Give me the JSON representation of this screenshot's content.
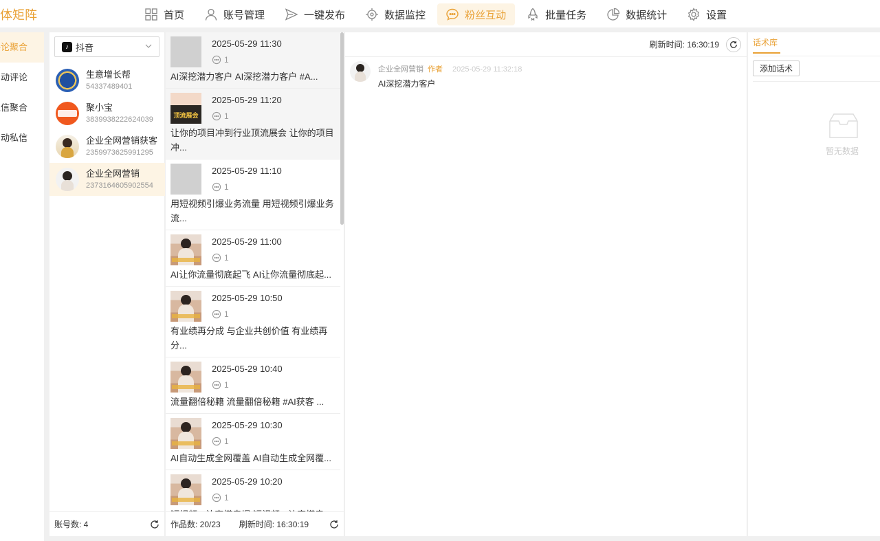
{
  "app": {
    "brand": "体矩阵"
  },
  "nav": [
    {
      "label": "首页",
      "icon": "grid-icon"
    },
    {
      "label": "账号管理",
      "icon": "user-icon"
    },
    {
      "label": "一键发布",
      "icon": "send-icon"
    },
    {
      "label": "数据监控",
      "icon": "target-icon"
    },
    {
      "label": "粉丝互动",
      "icon": "chat-icon",
      "active": true
    },
    {
      "label": "批量任务",
      "icon": "rocket-icon"
    },
    {
      "label": "数据统计",
      "icon": "pie-chart-icon"
    },
    {
      "label": "设置",
      "icon": "gear-icon"
    }
  ],
  "sidenav": [
    {
      "label": "评论聚合",
      "active": true
    },
    {
      "label": "自动评论"
    },
    {
      "label": "私信聚合"
    },
    {
      "label": "自动私信"
    }
  ],
  "platform": {
    "selected": "抖音"
  },
  "accounts": [
    {
      "name": "生意增长帮",
      "id": "54337489401"
    },
    {
      "name": "聚小宝",
      "id": "3839938222624039"
    },
    {
      "name": "企业全网营销获客",
      "id": "2359973625991295"
    },
    {
      "name": "企业全网营销",
      "id": "2373164605902554",
      "active": true
    }
  ],
  "accounts_footer": {
    "label": "账号数: 4"
  },
  "works": [
    {
      "time": "2025-05-29 11:30",
      "comments": "1",
      "title": "AI深挖潜力客户 AI深挖潜力客户 #A...",
      "selected": true,
      "thumb": "placeholder"
    },
    {
      "time": "2025-05-29 11:20",
      "comments": "1",
      "title": "让你的项目冲到行业顶流展会 让你的项目冲...",
      "selected": true,
      "thumb": "banner",
      "thumb_text": "顶流展会"
    },
    {
      "time": "2025-05-29 11:10",
      "comments": "1",
      "title": "用短视频引爆业务流量 用短视频引爆业务流...",
      "thumb": "placeholder"
    },
    {
      "time": "2025-05-29 11:00",
      "comments": "1",
      "title": "AI让你流量彻底起飞 AI让你流量彻底起...",
      "thumb": "photo"
    },
    {
      "time": "2025-05-29 10:50",
      "comments": "1",
      "title": "有业绩再分成 与企业共创价值 有业绩再分...",
      "thumb": "photo"
    },
    {
      "time": "2025-05-29 10:40",
      "comments": "1",
      "title": "流量翻倍秘籍 流量翻倍秘籍 #AI获客 ...",
      "thumb": "photo"
    },
    {
      "time": "2025-05-29 10:30",
      "comments": "1",
      "title": "AI自动生成全网覆盖 AI自动生成全网覆...",
      "thumb": "photo"
    },
    {
      "time": "2025-05-29 10:20",
      "comments": "1",
      "title": "短视频AI让穿搭卖爆 短视频AI让穿搭卖...",
      "thumb": "photo"
    }
  ],
  "works_footer": {
    "count": "作品数: 20/23",
    "refresh": "刷新时间: 16:30:19"
  },
  "comments_panel": {
    "refresh": "刷新时间: 16:30:19"
  },
  "comments": [
    {
      "author": "企业全网营销",
      "tag": "作者",
      "time": "2025-05-29 11:32:18",
      "text": "AI深挖潜力客户"
    }
  ],
  "scripts": {
    "tab": "话术库",
    "add_button": "添加话术",
    "empty": "暂无数据"
  },
  "colors": {
    "accent": "#e9a135",
    "accent_bg": "#fdf4e4"
  }
}
